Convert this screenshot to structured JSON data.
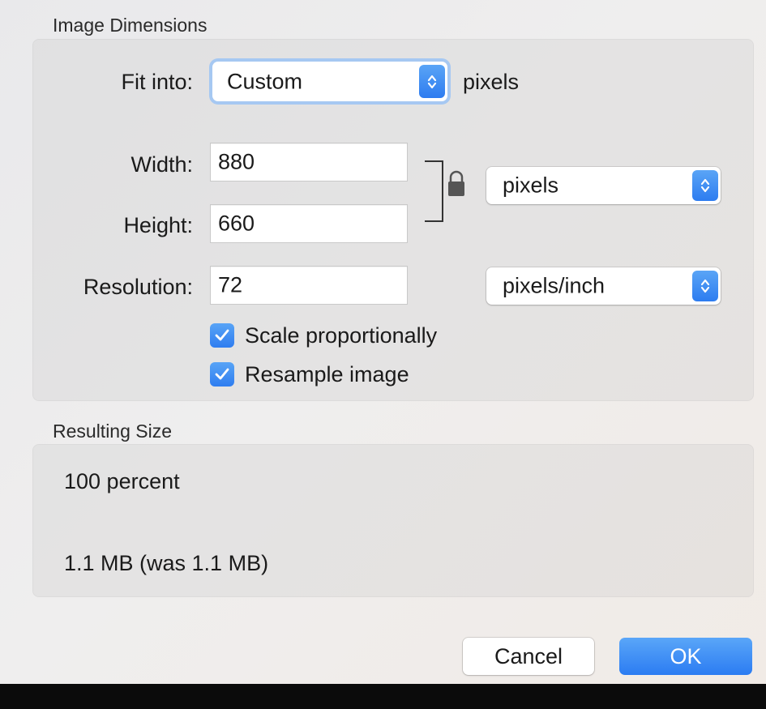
{
  "image_dimensions": {
    "section_title": "Image Dimensions",
    "fit_into": {
      "label": "Fit into:",
      "value": "Custom",
      "suffix": "pixels"
    },
    "width": {
      "label": "Width:",
      "value": "880"
    },
    "height": {
      "label": "Height:",
      "value": "660"
    },
    "resolution": {
      "label": "Resolution:",
      "value": "72"
    },
    "size_unit": {
      "value": "pixels"
    },
    "resolution_unit": {
      "value": "pixels/inch"
    },
    "scale_proportionally": {
      "label": "Scale proportionally",
      "checked": true
    },
    "resample_image": {
      "label": "Resample image",
      "checked": true
    },
    "lock_icon": "lock-icon"
  },
  "resulting_size": {
    "section_title": "Resulting Size",
    "percent": "100 percent",
    "file_size": "1.1 MB (was 1.1 MB)"
  },
  "buttons": {
    "cancel": "Cancel",
    "ok": "OK"
  },
  "colors": {
    "accent": "#2f7df0",
    "panel": "#e3e3e3"
  }
}
